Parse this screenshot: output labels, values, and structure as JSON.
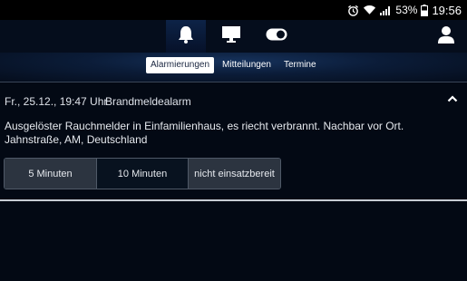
{
  "status_bar": {
    "icons": [
      "alarm-clock-icon",
      "wifi-icon",
      "signal-icon",
      "battery-icon"
    ],
    "battery": "53%",
    "time": "19:56"
  },
  "top_nav": {
    "icons": [
      "bell-icon",
      "monitor-icon",
      "toggle-icon",
      "user-icon"
    ],
    "active": "bell-icon"
  },
  "sub_nav": {
    "tabs": [
      {
        "label": "Alarmierungen",
        "active": true
      },
      {
        "label": "Mitteilungen",
        "active": false
      },
      {
        "label": "Termine",
        "active": false
      }
    ]
  },
  "alarm": {
    "datetime": "Fr., 25.12., 19:47 Uhr",
    "type": "Brandmeldealarm",
    "description_line1": "Ausgelöster Rauchmelder in Einfamilienhaus, es riecht verbrannt. Nachbar vor Ort.",
    "description_line2": "Jahnstraße, AM, Deutschland",
    "responses": [
      {
        "label": "5 Minuten"
      },
      {
        "label": "10 Minuten"
      },
      {
        "label": "nicht einsatzbereit"
      }
    ]
  },
  "colors": {
    "background": "#030914",
    "active_tab_bg": "#ffffff",
    "accent": "#16325c"
  }
}
